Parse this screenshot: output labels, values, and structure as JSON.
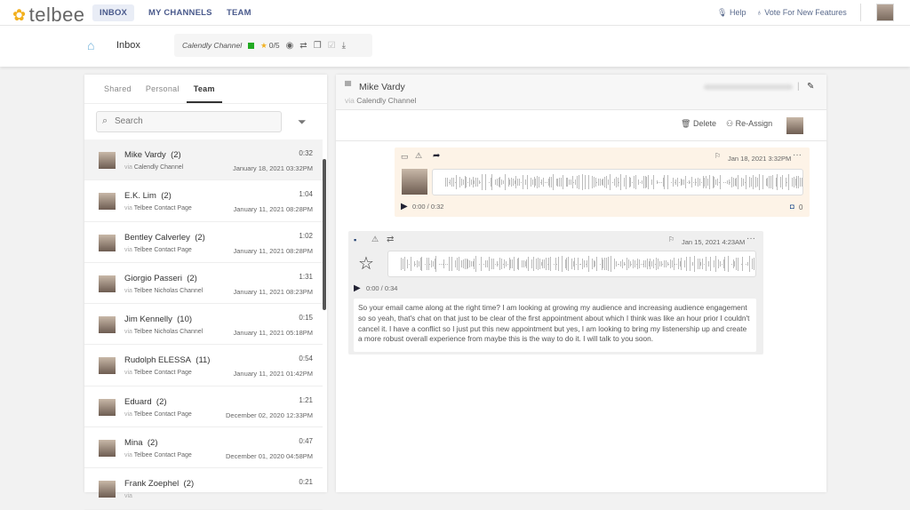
{
  "nav": {
    "brand": "telbee",
    "tabs": [
      "INBOX",
      "MY CHANNELS",
      "TEAM"
    ],
    "help": "Help",
    "vote": "Vote For New Features"
  },
  "subheader": {
    "title": "Inbox",
    "channel": "Calendly Channel",
    "rating": "0/5"
  },
  "left": {
    "tabs": [
      "Shared",
      "Personal",
      "Team"
    ],
    "search_placeholder": "Search",
    "items": [
      {
        "name": "Mike Vardy",
        "count": "(2)",
        "duration": "0:32",
        "via": "via",
        "channel": "Calendly Channel",
        "date": "January 18, 2021 03:32PM"
      },
      {
        "name": "E.K. Lim",
        "count": "(2)",
        "duration": "1:04",
        "via": "via",
        "channel": "Telbee Contact Page",
        "date": "January 11, 2021 08:28PM"
      },
      {
        "name": "Bentley Calverley",
        "count": "(2)",
        "duration": "1:02",
        "via": "via",
        "channel": "Telbee Contact Page",
        "date": "January 11, 2021 08:28PM"
      },
      {
        "name": "Giorgio Passeri",
        "count": "(2)",
        "duration": "1:31",
        "via": "via",
        "channel": "Telbee Nicholas Channel",
        "date": "January 11, 2021 08:23PM"
      },
      {
        "name": "Jim Kennelly",
        "count": "(10)",
        "duration": "0:15",
        "via": "via",
        "channel": "Telbee Nicholas Channel",
        "date": "January 11, 2021 05:18PM"
      },
      {
        "name": "Rudolph ELESSA",
        "count": "(11)",
        "duration": "0:54",
        "via": "via",
        "channel": "Telbee Contact Page",
        "date": "January 11, 2021 01:42PM"
      },
      {
        "name": "Eduard",
        "count": "(2)",
        "duration": "1:21",
        "via": "via",
        "channel": "Telbee Contact Page",
        "date": "December 02, 2020 12:33PM"
      },
      {
        "name": "Mina",
        "count": "(2)",
        "duration": "0:47",
        "via": "via",
        "channel": "Telbee Contact Page",
        "date": "December 01, 2020 04:58PM"
      },
      {
        "name": "Frank Zoephel",
        "count": "(2)",
        "duration": "0:21",
        "via": "via",
        "channel": "",
        "date": ""
      }
    ]
  },
  "conversation": {
    "name": "Mike Vardy",
    "via": "via",
    "channel": "Calendly Channel",
    "delete": "Delete",
    "reassign": "Re-Assign",
    "messages": [
      {
        "date": "Jan 18, 2021 3:32PM",
        "time": "0:00 / 0:32",
        "count": "0"
      },
      {
        "date": "Jan 15, 2021 4:23AM",
        "time": "0:00 / 0:34",
        "transcript": "So your email came along at the right time? I am looking at growing my audience and increasing audience engagement so so yeah, that's chat on that just to be clear of the first appointment about which I think was like an hour prior I couldn't cancel it. I have a conflict so I just put this new appointment but yes, I am looking to bring my listenership up and create a more robust overall experience from maybe this is the way to do it. I will talk to you soon."
      }
    ]
  }
}
